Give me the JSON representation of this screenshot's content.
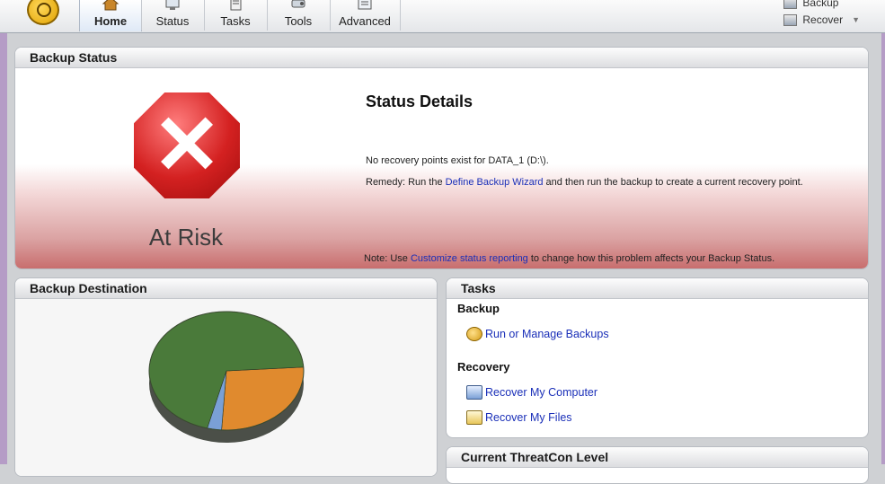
{
  "nav": {
    "tabs": [
      {
        "label": "Home",
        "icon": "home-icon",
        "active": true
      },
      {
        "label": "Status",
        "icon": "status-icon"
      },
      {
        "label": "Tasks",
        "icon": "tasks-icon"
      },
      {
        "label": "Tools",
        "icon": "tools-icon"
      },
      {
        "label": "Advanced",
        "icon": "advanced-icon"
      }
    ],
    "right_links": [
      {
        "label": "Backup",
        "icon": "backup-icon"
      },
      {
        "label": "Recover",
        "icon": "recover-icon"
      }
    ]
  },
  "backup_status": {
    "title": "Backup Status",
    "status_label": "At Risk",
    "status_icon": "error-x-icon",
    "details_title": "Status Details",
    "message": "No recovery points exist for DATA_1 (D:\\).",
    "remedy_prefix": "Remedy: Run the ",
    "remedy_link": "Define Backup Wizard",
    "remedy_suffix": " and then run the backup to create a current recovery point.",
    "note_prefix": "Note: Use ",
    "note_link": "Customize status reporting",
    "note_suffix": " to change how this problem affects your Backup Status."
  },
  "backup_destination": {
    "title": "Backup Destination",
    "chart_data": {
      "type": "pie",
      "slices": [
        {
          "fraction": 0.7,
          "color": "#4a7a3a"
        },
        {
          "fraction": 0.27,
          "color": "#e08a2e"
        },
        {
          "fraction": 0.03,
          "color": "#7aa0d6"
        }
      ]
    }
  },
  "tasks": {
    "title": "Tasks",
    "sections": [
      {
        "heading": "Backup",
        "items": [
          {
            "label": "Run or Manage Backups",
            "icon": "backup-drive-icon"
          }
        ]
      },
      {
        "heading": "Recovery",
        "items": [
          {
            "label": "Recover My Computer",
            "icon": "recover-computer-icon"
          },
          {
            "label": "Recover My Files",
            "icon": "recover-files-icon"
          }
        ]
      }
    ]
  },
  "threatcon": {
    "title": "Current ThreatCon Level"
  },
  "colors": {
    "link": "#1a2fb8",
    "risk_red": "#d42121",
    "window_edge": "#b59cc6"
  }
}
